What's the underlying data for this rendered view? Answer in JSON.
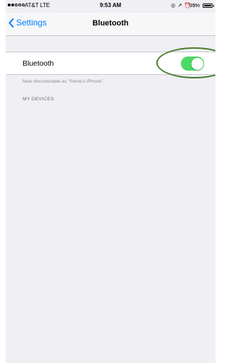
{
  "status_bar": {
    "carrier": "AT&T  LTE",
    "time": "9:53 AM",
    "icons": [
      "alarm-icon",
      "location-icon",
      "lock-rotation-icon",
      "headphones-icon"
    ],
    "indicators": "◎ ↗ ⏰ ∩",
    "battery_percent": "95%",
    "battery_level": 0.95,
    "signal_bars_filled": 2,
    "signal_bars_total": 5
  },
  "nav": {
    "back_label": "Settings",
    "title": "Bluetooth"
  },
  "bluetooth": {
    "label": "Bluetooth",
    "enabled": true,
    "toggle_color": "#4cd964",
    "discoverable_text": "Now discoverable as “Steve’s iPhone”."
  },
  "sections": {
    "my_devices_header": "MY DEVICES"
  },
  "colors": {
    "accent": "#007aff",
    "background": "#efeff4",
    "highlight_ring": "#4a7b2b"
  }
}
